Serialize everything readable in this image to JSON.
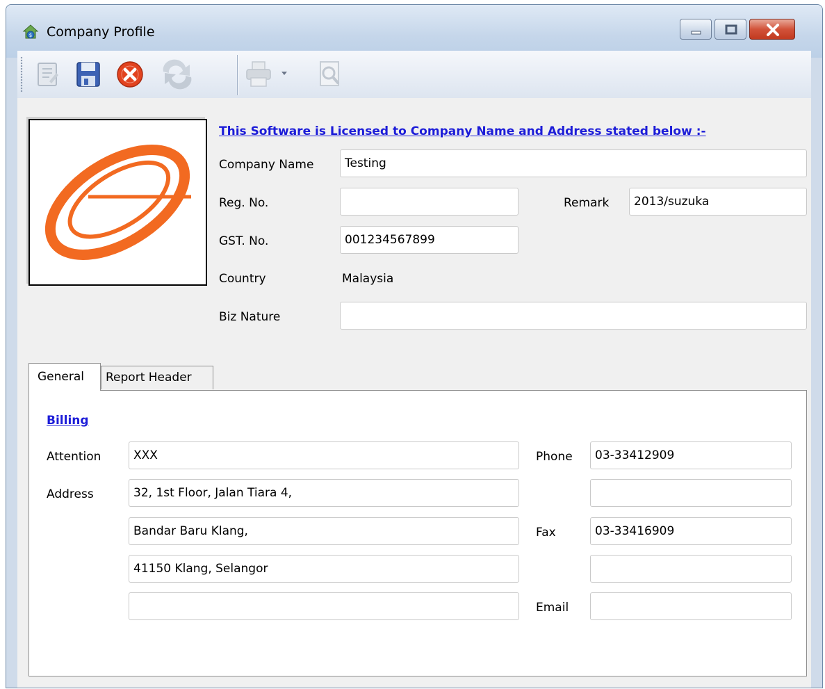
{
  "window": {
    "title": "Company Profile"
  },
  "toolbar": {
    "buttons": [
      "edit-icon",
      "save-icon",
      "cancel-icon",
      "refresh-icon",
      "print-icon",
      "preview-icon"
    ]
  },
  "license_text": "This Software is Licensed to Company Name and Address stated below :-",
  "company": {
    "company_name_label": "Company Name",
    "company_name": "Testing",
    "reg_no_label": "Reg. No.",
    "reg_no": "",
    "remark_label": "Remark",
    "remark": "2013/suzuka",
    "gst_no_label": "GST. No.",
    "gst_no": "001234567899",
    "country_label": "Country",
    "country": "Malaysia",
    "biz_nature_label": "Biz Nature",
    "biz_nature": ""
  },
  "tabs": {
    "general": "General",
    "report_header": "Report Header"
  },
  "billing": {
    "heading": "Billing",
    "attention_label": "Attention",
    "attention": "XXX",
    "address_label": "Address",
    "address1": "32, 1st Floor, Jalan Tiara 4,",
    "address2": " Bandar Baru Klang,",
    "address3": "41150 Klang, Selangor",
    "address4": "",
    "phone_label": "Phone",
    "phone1": "03-33412909",
    "phone2": "",
    "fax_label": "Fax",
    "fax1": "03-33416909",
    "fax2": "",
    "email_label": "Email",
    "email": ""
  },
  "colors": {
    "link_blue": "#1c1cd8",
    "logo_orange": "#f26a21",
    "close_red": "#c23a20"
  }
}
